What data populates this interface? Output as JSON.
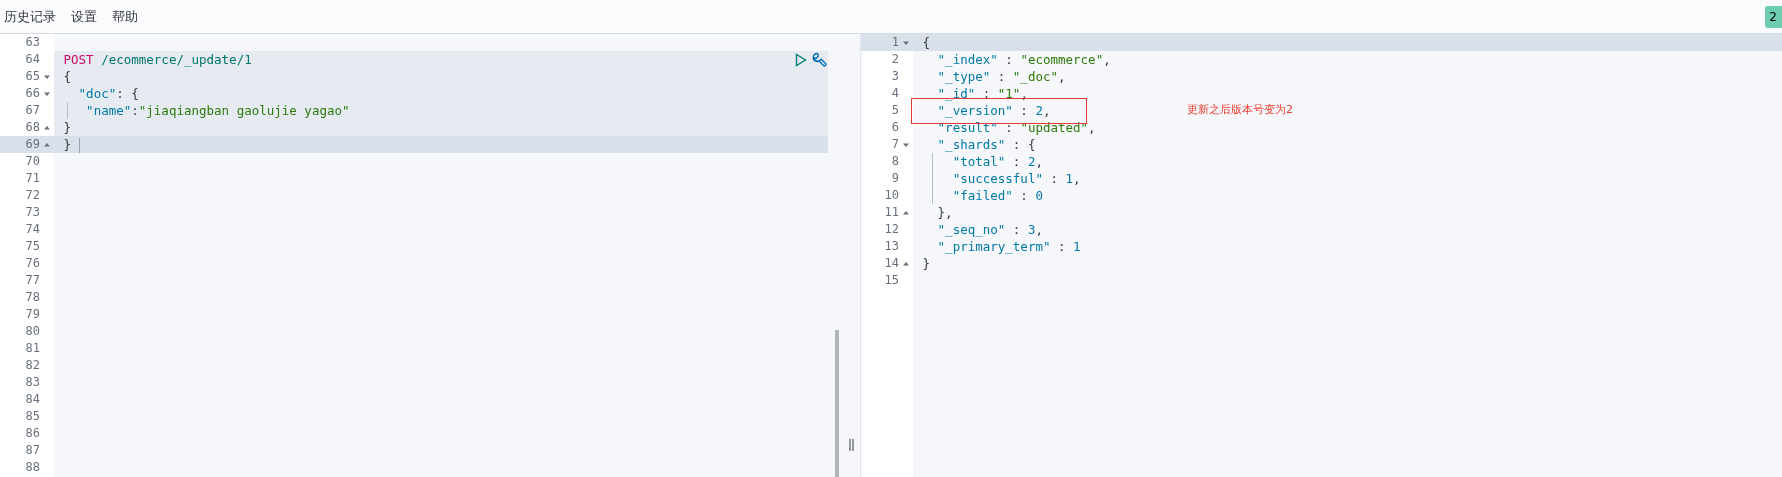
{
  "menu": [
    {
      "label": "历史记录"
    },
    {
      "label": "设置"
    },
    {
      "label": "帮助"
    }
  ],
  "badge": "2",
  "request_editor": {
    "lines": [
      {
        "number": "63",
        "kind": "plain",
        "active": false,
        "in_request": false,
        "guide": false
      },
      {
        "number": "64",
        "kind": "plain",
        "active": false,
        "in_request": true,
        "guide": false,
        "actions": true,
        "tokens": [
          {
            "kind": "method",
            "text": "POST"
          },
          {
            "kind": "path",
            "text": " /ecommerce/_update/1"
          }
        ]
      },
      {
        "number": "65",
        "kind": "fold-start",
        "active": false,
        "in_request": true,
        "guide": false,
        "tokens": [
          {
            "kind": "punct",
            "text": "{"
          }
        ]
      },
      {
        "number": "66",
        "kind": "fold-start",
        "active": false,
        "in_request": true,
        "guide": false,
        "tokens": [
          {
            "kind": "key",
            "text": "  \"doc\""
          },
          {
            "kind": "punct",
            "text": ": {"
          }
        ]
      },
      {
        "number": "67",
        "kind": "plain",
        "active": false,
        "in_request": true,
        "guide": true,
        "tokens": [
          {
            "kind": "key",
            "text": "   \"name\""
          },
          {
            "kind": "punct",
            "text": ":"
          },
          {
            "kind": "string",
            "text": "\"jiaqiangban gaolujie yagao\""
          }
        ]
      },
      {
        "number": "68",
        "kind": "fold-end",
        "active": false,
        "in_request": true,
        "guide": false,
        "tokens": [
          {
            "kind": "punct",
            "text": "}"
          }
        ]
      },
      {
        "number": "69",
        "kind": "fold-end",
        "active": true,
        "in_request": true,
        "guide": false,
        "tokens": [
          {
            "kind": "punct",
            "text": "}"
          }
        ]
      },
      {
        "number": "70",
        "kind": "plain",
        "active": false,
        "in_request": false,
        "guide": false
      },
      {
        "number": "71",
        "kind": "plain",
        "active": false,
        "in_request": false,
        "guide": false
      },
      {
        "number": "72",
        "kind": "plain",
        "active": false,
        "in_request": false,
        "guide": false
      },
      {
        "number": "73",
        "kind": "plain",
        "active": false,
        "in_request": false,
        "guide": false
      },
      {
        "number": "74",
        "kind": "plain",
        "active": false,
        "in_request": false,
        "guide": false
      },
      {
        "number": "75",
        "kind": "plain",
        "active": false,
        "in_request": false,
        "guide": false
      },
      {
        "number": "76",
        "kind": "plain",
        "active": false,
        "in_request": false,
        "guide": false
      },
      {
        "number": "77",
        "kind": "plain",
        "active": false,
        "in_request": false,
        "guide": false
      },
      {
        "number": "78",
        "kind": "plain",
        "active": false,
        "in_request": false,
        "guide": false
      },
      {
        "number": "79",
        "kind": "plain",
        "active": false,
        "in_request": false,
        "guide": false
      },
      {
        "number": "80",
        "kind": "plain",
        "active": false,
        "in_request": false,
        "guide": false
      },
      {
        "number": "81",
        "kind": "plain",
        "active": false,
        "in_request": false,
        "guide": false
      },
      {
        "number": "82",
        "kind": "plain",
        "active": false,
        "in_request": false,
        "guide": false
      },
      {
        "number": "83",
        "kind": "plain",
        "active": false,
        "in_request": false,
        "guide": false
      },
      {
        "number": "84",
        "kind": "plain",
        "active": false,
        "in_request": false,
        "guide": false
      },
      {
        "number": "85",
        "kind": "plain",
        "active": false,
        "in_request": false,
        "guide": false
      },
      {
        "number": "86",
        "kind": "plain",
        "active": false,
        "in_request": false,
        "guide": false
      },
      {
        "number": "87",
        "kind": "plain",
        "active": false,
        "in_request": false,
        "guide": false
      },
      {
        "number": "88",
        "kind": "plain",
        "active": false,
        "in_request": false,
        "guide": false
      }
    ]
  },
  "response_editor": {
    "lines": [
      {
        "number": "1",
        "kind": "fold-start",
        "active": true,
        "guide": false,
        "tokens": [
          {
            "kind": "punct",
            "text": "{"
          }
        ]
      },
      {
        "number": "2",
        "kind": "plain",
        "active": false,
        "guide": false,
        "tokens": [
          {
            "kind": "key",
            "text": "  \"_index\""
          },
          {
            "kind": "punct",
            "text": " : "
          },
          {
            "kind": "string",
            "text": "\"ecommerce\""
          },
          {
            "kind": "punct",
            "text": ","
          }
        ]
      },
      {
        "number": "3",
        "kind": "plain",
        "active": false,
        "guide": false,
        "tokens": [
          {
            "kind": "key",
            "text": "  \"_type\""
          },
          {
            "kind": "punct",
            "text": " : "
          },
          {
            "kind": "string",
            "text": "\"_doc\""
          },
          {
            "kind": "punct",
            "text": ","
          }
        ]
      },
      {
        "number": "4",
        "kind": "plain",
        "active": false,
        "guide": false,
        "tokens": [
          {
            "kind": "key",
            "text": "  \"_id\""
          },
          {
            "kind": "punct",
            "text": " : "
          },
          {
            "kind": "string",
            "text": "\"1\""
          },
          {
            "kind": "punct",
            "text": ","
          }
        ]
      },
      {
        "number": "5",
        "kind": "plain",
        "active": false,
        "guide": false,
        "tokens": [
          {
            "kind": "key",
            "text": "  \"_version\""
          },
          {
            "kind": "punct",
            "text": " : "
          },
          {
            "kind": "number",
            "text": "2"
          },
          {
            "kind": "punct",
            "text": ","
          }
        ]
      },
      {
        "number": "6",
        "kind": "plain",
        "active": false,
        "guide": false,
        "tokens": [
          {
            "kind": "key",
            "text": "  \"result\""
          },
          {
            "kind": "punct",
            "text": " : "
          },
          {
            "kind": "string",
            "text": "\"updated\""
          },
          {
            "kind": "punct",
            "text": ","
          }
        ]
      },
      {
        "number": "7",
        "kind": "fold-start",
        "active": false,
        "guide": false,
        "tokens": [
          {
            "kind": "key",
            "text": "  \"_shards\""
          },
          {
            "kind": "punct",
            "text": " : {"
          }
        ]
      },
      {
        "number": "8",
        "kind": "plain",
        "active": false,
        "guide": true,
        "tokens": [
          {
            "kind": "key",
            "text": "    \"total\""
          },
          {
            "kind": "punct",
            "text": " : "
          },
          {
            "kind": "number",
            "text": "2"
          },
          {
            "kind": "punct",
            "text": ","
          }
        ]
      },
      {
        "number": "9",
        "kind": "plain",
        "active": false,
        "guide": true,
        "tokens": [
          {
            "kind": "key",
            "text": "    \"successful\""
          },
          {
            "kind": "punct",
            "text": " : "
          },
          {
            "kind": "number",
            "text": "1"
          },
          {
            "kind": "punct",
            "text": ","
          }
        ]
      },
      {
        "number": "10",
        "kind": "plain",
        "active": false,
        "guide": true,
        "tokens": [
          {
            "kind": "key",
            "text": "    \"failed\""
          },
          {
            "kind": "punct",
            "text": " : "
          },
          {
            "kind": "number",
            "text": "0"
          }
        ]
      },
      {
        "number": "11",
        "kind": "fold-end",
        "active": false,
        "guide": false,
        "tokens": [
          {
            "kind": "punct",
            "text": "  },"
          }
        ]
      },
      {
        "number": "12",
        "kind": "plain",
        "active": false,
        "guide": false,
        "tokens": [
          {
            "kind": "key",
            "text": "  \"_seq_no\""
          },
          {
            "kind": "punct",
            "text": " : "
          },
          {
            "kind": "number",
            "text": "3"
          },
          {
            "kind": "punct",
            "text": ","
          }
        ]
      },
      {
        "number": "13",
        "kind": "plain",
        "active": false,
        "guide": false,
        "tokens": [
          {
            "kind": "key",
            "text": "  \"_primary_term\""
          },
          {
            "kind": "punct",
            "text": " : "
          },
          {
            "kind": "number",
            "text": "1"
          }
        ]
      },
      {
        "number": "14",
        "kind": "fold-end",
        "active": false,
        "guide": false,
        "tokens": [
          {
            "kind": "punct",
            "text": "}"
          }
        ]
      },
      {
        "number": "15",
        "kind": "plain",
        "active": false,
        "guide": false
      }
    ],
    "annotation": {
      "text": "更新之后版本号变为2"
    }
  }
}
